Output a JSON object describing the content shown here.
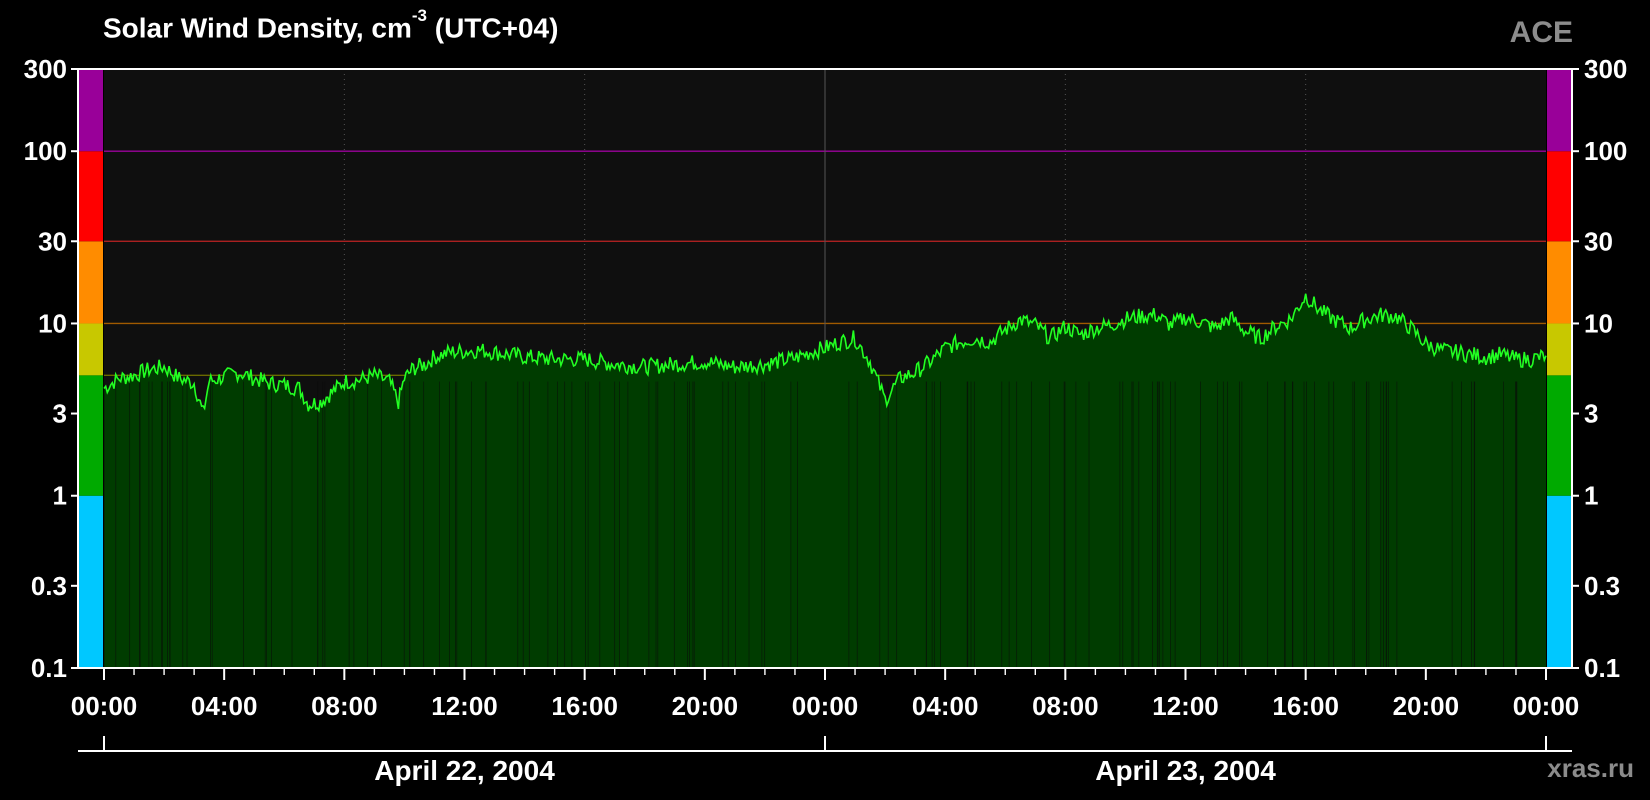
{
  "title": {
    "main": "Solar Wind Density, cm",
    "superscript": "-3",
    "suffix": "(UTC+04)"
  },
  "source_label": "ACE",
  "credit": "xras.ru",
  "colors": {
    "background": "#000000",
    "plot_bg": "#0f0f0f",
    "fill": "#003c00",
    "line": "#22ff22",
    "frame": "#ffffff",
    "scale_bands": [
      {
        "from": 0.1,
        "to": 1,
        "color": "#00c8ff"
      },
      {
        "from": 1,
        "to": 5,
        "color": "#00aa00"
      },
      {
        "from": 5,
        "to": 10,
        "color": "#c8c800"
      },
      {
        "from": 10,
        "to": 30,
        "color": "#ff8c00"
      },
      {
        "from": 30,
        "to": 100,
        "color": "#ff0000"
      },
      {
        "from": 100,
        "to": 300,
        "color": "#990099"
      }
    ],
    "threshold_lines": [
      {
        "value": 100,
        "color": "#990099"
      },
      {
        "value": 30,
        "color": "#aa2020"
      },
      {
        "value": 10,
        "color": "#a05a00"
      },
      {
        "value": 5,
        "color": "#6a6a00"
      }
    ]
  },
  "chart_data": {
    "type": "area",
    "title": "Solar Wind Density, cm-3 (UTC+04)",
    "xlabel": "",
    "ylabel": "",
    "y_scale": "log",
    "ylim": [
      0.1,
      300
    ],
    "xlim_hours": [
      0,
      48
    ],
    "y_ticks": [
      "300",
      "100",
      "30",
      "10",
      "3",
      "1",
      "0.3",
      "0.1"
    ],
    "y_tick_values": [
      300,
      100,
      30,
      10,
      3,
      1,
      0.3,
      0.1
    ],
    "x_ticks": [
      "00:00",
      "04:00",
      "08:00",
      "12:00",
      "16:00",
      "20:00",
      "00:00",
      "04:00",
      "08:00",
      "12:00",
      "16:00",
      "20:00",
      "00:00"
    ],
    "x_tick_hours": [
      0,
      4,
      8,
      12,
      16,
      20,
      24,
      28,
      32,
      36,
      40,
      44,
      48
    ],
    "dates": [
      {
        "label": "April 22, 2004",
        "start_hour": 0,
        "end_hour": 24
      },
      {
        "label": "April 23, 2004",
        "start_hour": 24,
        "end_hour": 48
      }
    ],
    "series": [
      {
        "x_hours": [
          0,
          0.5,
          1,
          1.5,
          2,
          2.5,
          3,
          3.3,
          3.5,
          4,
          4.5,
          5,
          5.5,
          6,
          6.5,
          6.8,
          7.2,
          7.6,
          8,
          8.5,
          9,
          9.5,
          9.8,
          10,
          10.3,
          10.7,
          11,
          11.5,
          12,
          12.5,
          13,
          13.5,
          14,
          15,
          16,
          17,
          18,
          19,
          20,
          21,
          22,
          23,
          23.5,
          24,
          24.5,
          25,
          25.5,
          26,
          26.5,
          27,
          27.5,
          28,
          28.5,
          29,
          29.5,
          30,
          30.5,
          31,
          31.5,
          32,
          32.5,
          33,
          33.5,
          34,
          34.5,
          35,
          35.5,
          36,
          36.5,
          37,
          37.5,
          38,
          38.5,
          39,
          39.5,
          40,
          40.5,
          41,
          41.5,
          42,
          42.5,
          43,
          43.5,
          44,
          44.5,
          45,
          45.5,
          46,
          46.5,
          47,
          47.5,
          48
        ],
        "values": [
          4.2,
          4.8,
          5.0,
          5.4,
          5.6,
          4.8,
          4.5,
          3.0,
          4.6,
          4.9,
          5.2,
          4.8,
          4.5,
          4.4,
          4.2,
          3.4,
          3.5,
          4.0,
          4.6,
          4.7,
          5.0,
          4.6,
          3.5,
          4.8,
          5.5,
          5.8,
          6.4,
          6.8,
          6.9,
          7.0,
          6.8,
          6.6,
          6.4,
          6.2,
          6.2,
          5.8,
          5.6,
          5.8,
          6.0,
          5.6,
          5.8,
          6.3,
          6.8,
          7.2,
          7.8,
          8.2,
          6.0,
          3.6,
          4.8,
          5.2,
          6.0,
          7.2,
          7.8,
          8.2,
          7.8,
          9.2,
          10.5,
          9.8,
          8.2,
          9.6,
          8.6,
          9.4,
          9.8,
          10.6,
          11.0,
          11.2,
          9.8,
          10.8,
          10.2,
          9.4,
          10.8,
          9.0,
          8.2,
          9.6,
          10.6,
          14.5,
          11.8,
          10.4,
          9.4,
          10.6,
          11.2,
          11.0,
          9.4,
          7.6,
          7.0,
          6.8,
          6.6,
          6.4,
          6.6,
          6.2,
          6.2,
          6.5
        ]
      }
    ]
  }
}
